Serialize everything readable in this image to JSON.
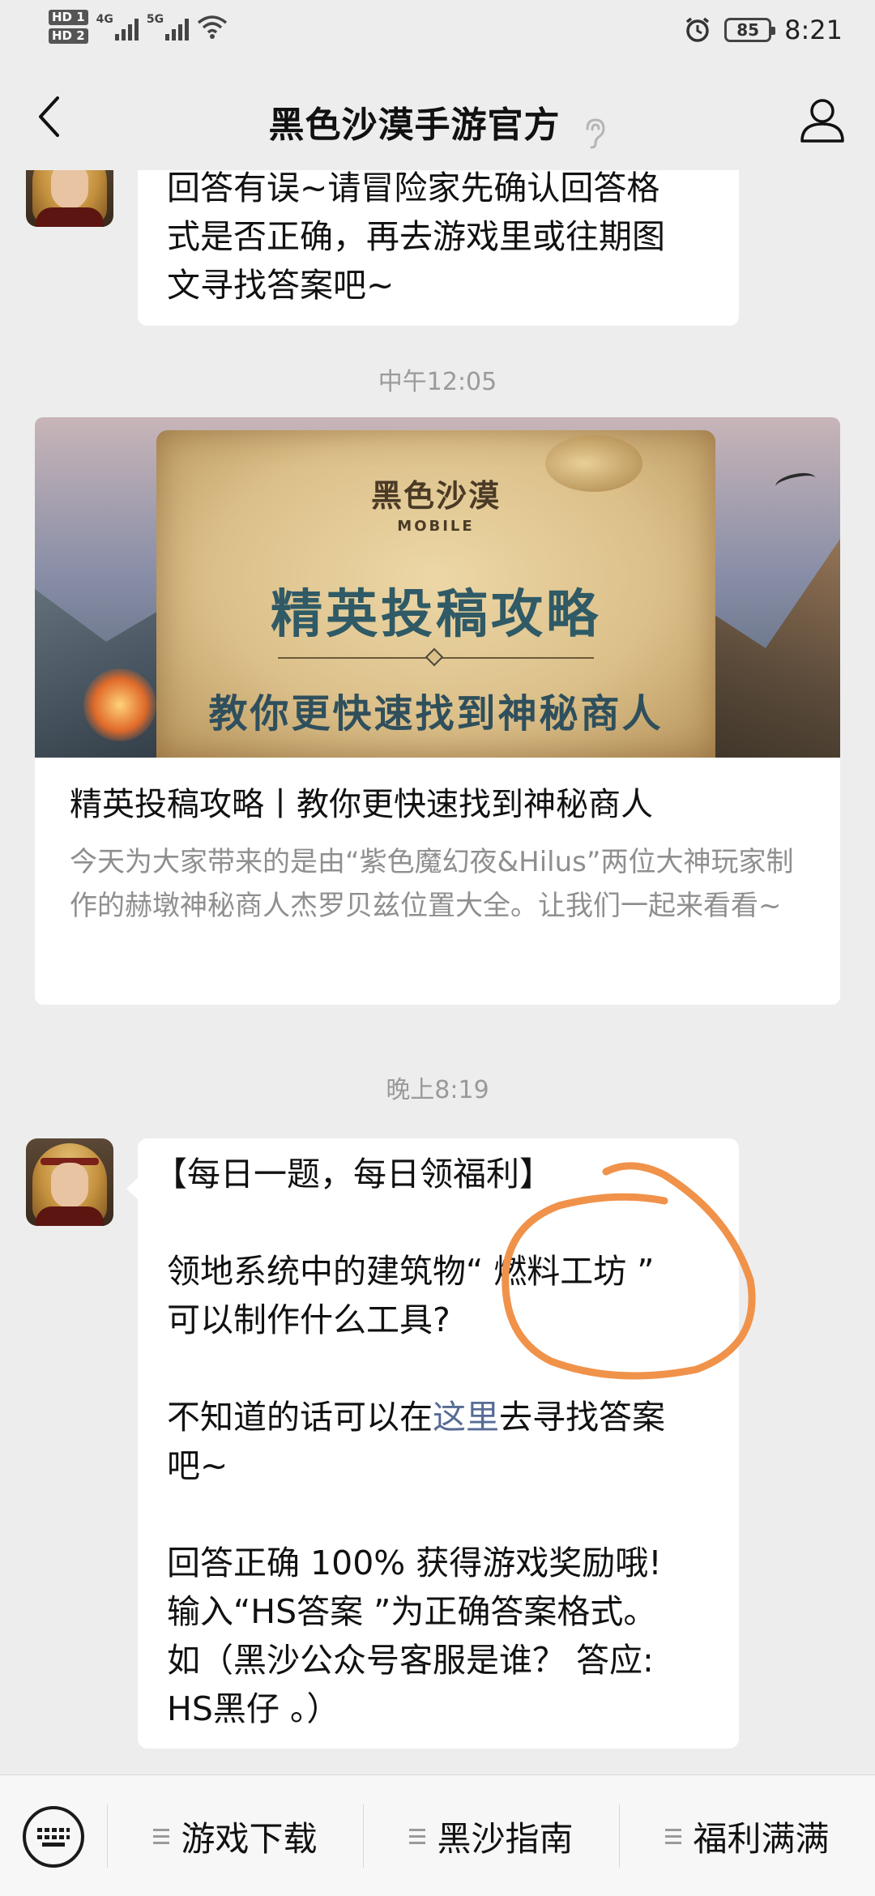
{
  "status_bar": {
    "sim1": "HD 1",
    "sim2": "HD 2",
    "net1": "4G",
    "net2": "5G",
    "battery": "85",
    "time": "8:21"
  },
  "header": {
    "title": "黑色沙漠手游官方"
  },
  "messages": {
    "first_bubble": "回答有误~请冒险家先确认回答格\n式是否正确，再去游戏里或往期图\n文寻找答案吧~",
    "time1": "中午12:05",
    "article": {
      "cover_logo_cn": "黑色沙漠",
      "cover_logo_en": "MOBILE",
      "cover_title": "精英投稿攻略",
      "cover_subtitle": "教你更快速找到神秘商人",
      "title": "精英投稿攻略丨教你更快速找到神秘商人",
      "desc": "今天为大家带来的是由“紫色魔幻夜&Hilus”两位大神玩家制作的赫墩神秘商人杰罗贝兹位置大全。让我们一起来看看~"
    },
    "time2": "晚上8:19",
    "daily": {
      "header": "【每日一题，每日领福利】",
      "question": "领地系统中的建筑物“ 燃料工坊 ”\n可以制作什么工具?",
      "hint_before": "不知道的话可以在",
      "hint_link": "这里",
      "hint_after": "去寻找答案\n吧~",
      "reward": "回答正确 100% 获得游戏奖励哦!\n输入“HS答案 ”为正确答案格式。\n如（黑沙公众号客服是谁？ 答应:\nHS黑仔 。）"
    }
  },
  "menu": {
    "items": [
      "游戏下载",
      "黑沙指南",
      "福利满满"
    ]
  },
  "colors": {
    "background": "#ededed",
    "link": "#576b95",
    "annotation": "#f0924a"
  }
}
